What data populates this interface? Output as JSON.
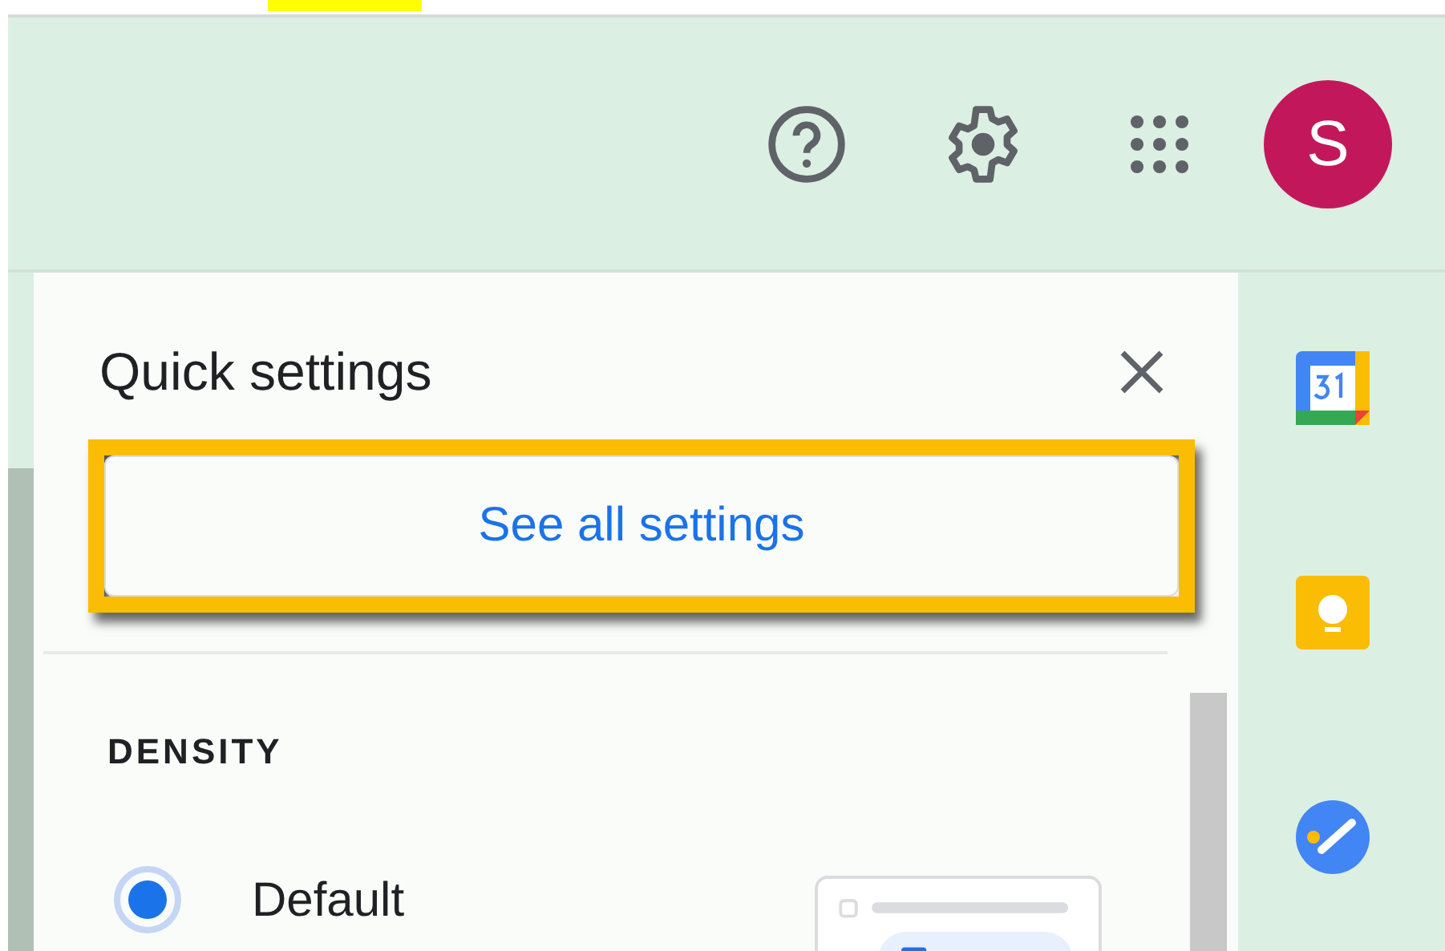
{
  "header": {
    "avatar_letter": "S"
  },
  "quick_settings": {
    "title": "Quick settings",
    "see_all_button": {
      "label": "See all settings",
      "highlighted": true
    },
    "section_title": "DENSITY",
    "options": [
      {
        "label": "Default",
        "selected": true
      }
    ]
  }
}
